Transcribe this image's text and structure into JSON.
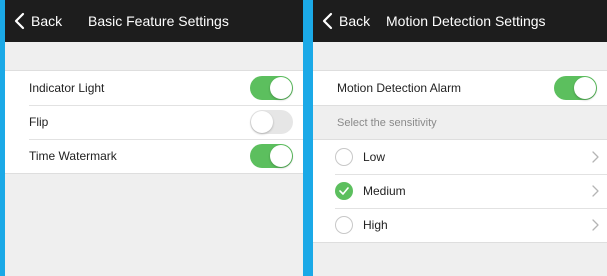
{
  "left_screen": {
    "back_label": "Back",
    "title": "Basic Feature Settings",
    "items": [
      {
        "label": "Indicator Light",
        "enabled": true
      },
      {
        "label": "Flip",
        "enabled": false
      },
      {
        "label": "Time Watermark",
        "enabled": true
      }
    ]
  },
  "right_screen": {
    "back_label": "Back",
    "title": "Motion Detection Settings",
    "alarm": {
      "label": "Motion Detection Alarm",
      "enabled": true
    },
    "sensitivity_header": "Select the sensitivity",
    "sensitivity_options": [
      {
        "label": "Low",
        "selected": false
      },
      {
        "label": "Medium",
        "selected": true
      },
      {
        "label": "High",
        "selected": false
      }
    ]
  },
  "colors": {
    "background_accent": "#1ba9e7",
    "navbar": "#1d1d1d",
    "toggle_on": "#5cbf5e",
    "toggle_off": "#e6e6e6",
    "panel_background": "#efefef"
  },
  "icons": {
    "back": "chevron-left-icon",
    "check": "checkmark-icon",
    "row_arrow": "chevron-right-icon"
  }
}
